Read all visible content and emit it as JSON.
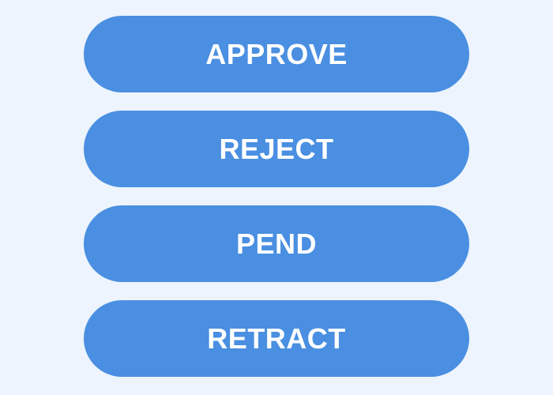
{
  "buttons": {
    "approve_label": "APPROVE",
    "reject_label": "REJECT",
    "pend_label": "PEND",
    "retract_label": "RETRACT"
  },
  "colors": {
    "background": "#edf4fd",
    "button": "#4a8fe1",
    "button_text": "#ffffff"
  }
}
